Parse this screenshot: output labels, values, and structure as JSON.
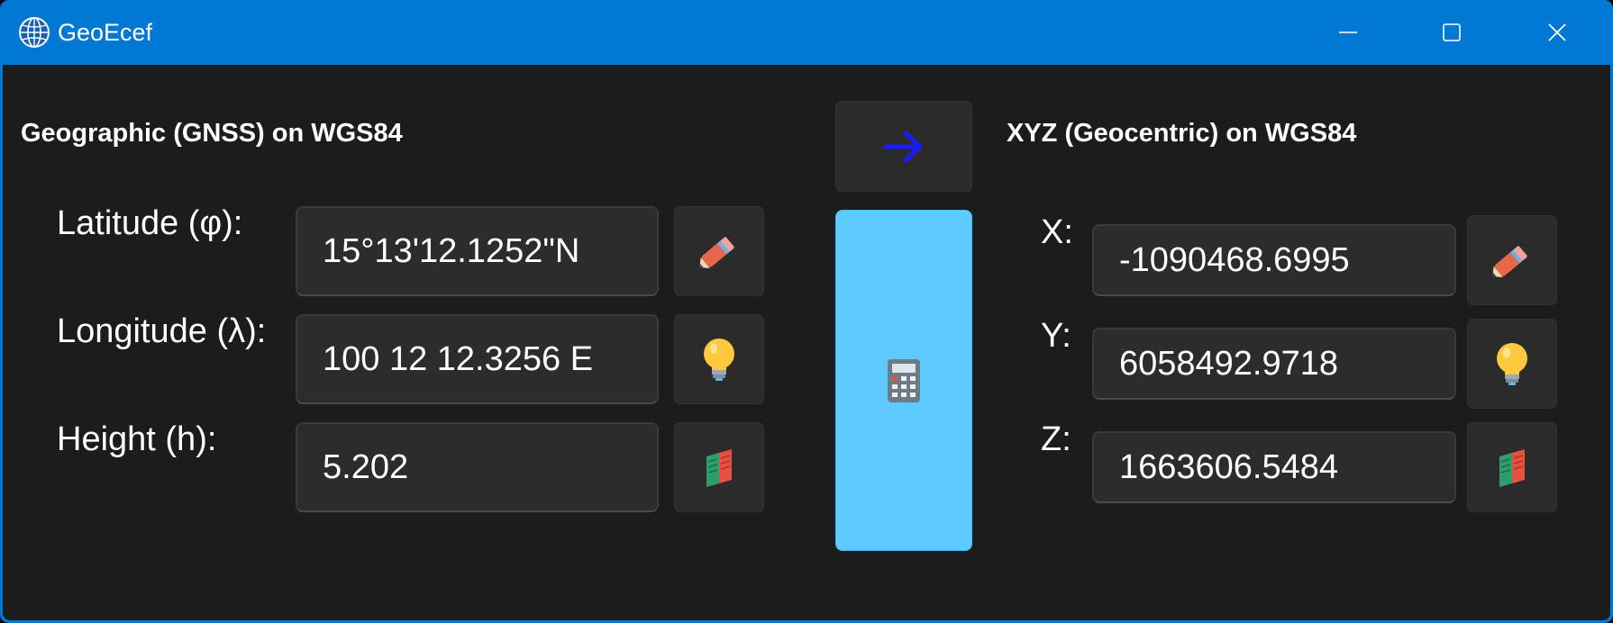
{
  "window": {
    "title": "GeoEcef",
    "icon": "globe-icon",
    "controls": {
      "minimize_icon": "minimize-icon",
      "maximize_icon": "maximize-icon",
      "close_icon": "close-icon"
    },
    "accent_color": "#0078d4"
  },
  "geographic": {
    "title": "Geographic (GNSS) on WGS84",
    "fields": [
      {
        "label": "Latitude (φ):",
        "value": "15°13'12.1252\"N",
        "icon": "pencil-icon"
      },
      {
        "label": "Longitude (λ):",
        "value": "100 12 12.3256 E",
        "icon": "lightbulb-icon"
      },
      {
        "label": "Height (h):",
        "value": "5.202",
        "icon": "book-icon"
      }
    ]
  },
  "center": {
    "direction_icon": "arrow-right-icon",
    "direction_color": "#1a1aff",
    "calculate_icon": "calculator-icon",
    "calculate_color": "#5fcaff"
  },
  "geocentric": {
    "title": "XYZ (Geocentric) on WGS84",
    "fields": [
      {
        "label": "X:",
        "value": "-1090468.6995",
        "icon": "pencil-icon"
      },
      {
        "label": "Y:",
        "value": "6058492.9718",
        "icon": "lightbulb-icon"
      },
      {
        "label": "Z:",
        "value": "1663606.5484",
        "icon": "book-icon"
      }
    ]
  }
}
